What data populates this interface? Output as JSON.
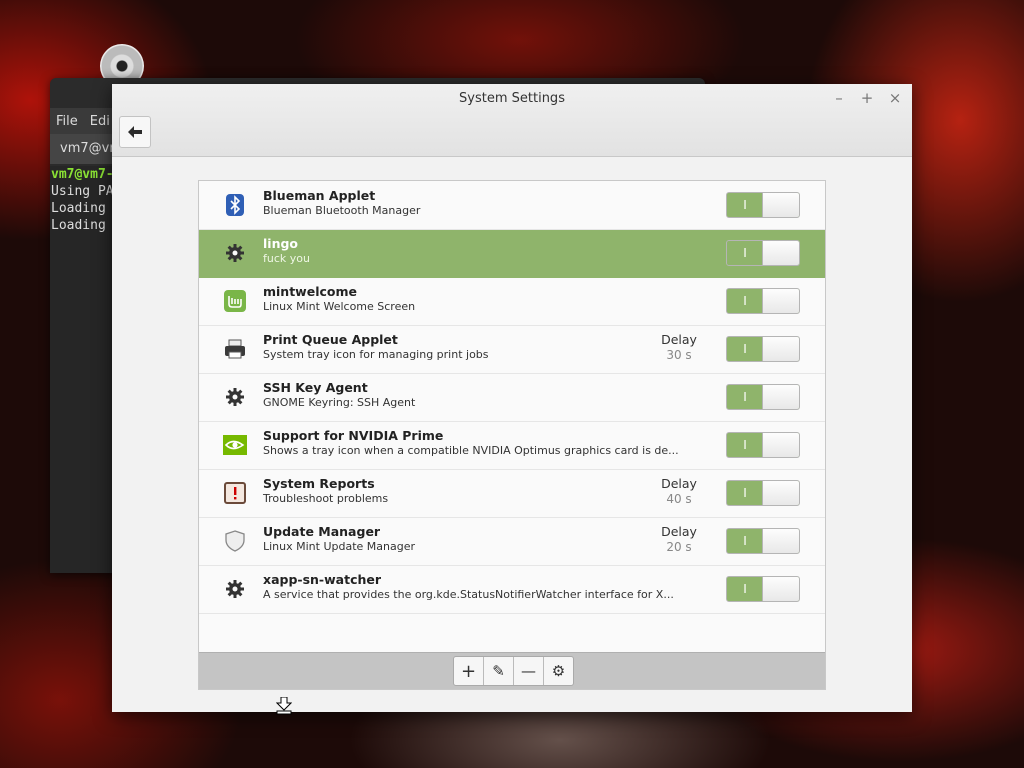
{
  "terminal": {
    "menu": [
      "File",
      "Edi"
    ],
    "tab_label": "vm7@vm",
    "lines": [
      {
        "text": "vm7@vm7-",
        "prompt": true
      },
      {
        "text": "Using PA",
        "prompt": false
      },
      {
        "text": "Loading",
        "prompt": false
      },
      {
        "text": "Loading",
        "prompt": false
      }
    ]
  },
  "window": {
    "title": "System Settings",
    "controls": {
      "minimize": "–",
      "maximize": "+",
      "close": "×"
    },
    "back_label": "🡐"
  },
  "startup_apps": [
    {
      "name": "Blueman Applet",
      "description": "Blueman Bluetooth Manager",
      "icon": "bluetooth-icon",
      "delay_label": "",
      "delay_value": "",
      "enabled": true,
      "selected": false
    },
    {
      "name": "lingo",
      "description": "fuck you",
      "icon": "gear-icon",
      "delay_label": "",
      "delay_value": "",
      "enabled": true,
      "selected": true
    },
    {
      "name": "mintwelcome",
      "description": "Linux Mint Welcome Screen",
      "icon": "mint-icon",
      "delay_label": "",
      "delay_value": "",
      "enabled": true,
      "selected": false
    },
    {
      "name": "Print Queue Applet",
      "description": "System tray icon for managing print jobs",
      "icon": "printer-icon",
      "delay_label": "Delay",
      "delay_value": "30 s",
      "enabled": true,
      "selected": false
    },
    {
      "name": "SSH Key Agent",
      "description": "GNOME Keyring: SSH Agent",
      "icon": "gear-icon",
      "delay_label": "",
      "delay_value": "",
      "enabled": true,
      "selected": false
    },
    {
      "name": "Support for NVIDIA Prime",
      "description": "Shows a tray icon when a compatible NVIDIA Optimus graphics card is de...",
      "icon": "nvidia-icon",
      "delay_label": "",
      "delay_value": "",
      "enabled": true,
      "selected": false
    },
    {
      "name": "System Reports",
      "description": "Troubleshoot problems",
      "icon": "report-icon",
      "delay_label": "Delay",
      "delay_value": "40 s",
      "enabled": true,
      "selected": false
    },
    {
      "name": "Update Manager",
      "description": "Linux Mint Update Manager",
      "icon": "shield-icon",
      "delay_label": "Delay",
      "delay_value": "20 s",
      "enabled": true,
      "selected": false
    },
    {
      "name": "xapp-sn-watcher",
      "description": "A service that provides the org.kde.StatusNotifierWatcher interface for X...",
      "icon": "gear-icon",
      "delay_label": "",
      "delay_value": "",
      "enabled": true,
      "selected": false
    }
  ],
  "toggle_on_label": "I",
  "toolbar": {
    "add": "+",
    "edit": "✎",
    "remove": "—",
    "settings": "⚙"
  },
  "colors": {
    "accent": "#8fb46b",
    "selected_row": "#8fb46b"
  }
}
